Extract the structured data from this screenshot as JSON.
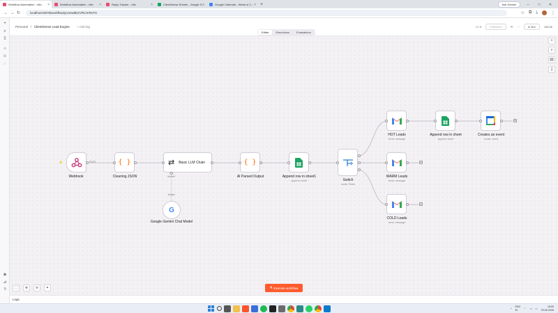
{
  "browser": {
    "tabs": [
      {
        "label": "Workflow Automation - n8n",
        "active": true,
        "color": "#ea4b71"
      },
      {
        "label": "Workflow Automation - n8n",
        "active": false,
        "color": "#ea4b71"
      },
      {
        "label": "Reply Tracker - n8n",
        "active": false,
        "color": "#ea4b71"
      },
      {
        "label": "ClientSense Sheets - Google S...",
        "active": false,
        "color": "#1ea362"
      },
      {
        "label": "Google Calendar - Week of 2...",
        "active": false,
        "color": "#4285f4"
      }
    ],
    "ask_label": "Ask Gemini",
    "url": "localhost:5678/workflow/yUnnw9DzVRCXrRvTS"
  },
  "header": {
    "breadcrumb_root": "Personal",
    "breadcrumb_sep": "/",
    "workflow_name": "ClientSense Lead Engine",
    "add_tag": "+ Add tag",
    "tabs": [
      "Editor",
      "Executions",
      "Evaluations"
    ],
    "counter": "0 / 0",
    "published": "Published",
    "star_label": "Star",
    "star_count": "163.0k"
  },
  "nodes": {
    "webhook": {
      "label": "Webhook",
      "edge": "POST"
    },
    "cleaning": {
      "label": "Cleaning JSON"
    },
    "llm": {
      "label": "Basic LLM Chain",
      "model_port": "Model*"
    },
    "gemini": {
      "label": "Google Gemini Chat Model",
      "edge": "Model"
    },
    "parsed": {
      "label": "AI Parsed Output"
    },
    "append1": {
      "label": "Append row in sheet1",
      "sub": "append: sheet"
    },
    "switch": {
      "label": "Switch",
      "sub": "mode: Rules"
    },
    "hot": {
      "label": "HOT Leads",
      "sub": "send: message"
    },
    "append2": {
      "label": "Append row in sheet",
      "sub": "append: sheet"
    },
    "event": {
      "label": "Creates an event",
      "sub": "create: event"
    },
    "warm": {
      "label": "WARM Leads",
      "sub": "send: message"
    },
    "cold": {
      "label": "COLD Leads",
      "sub": "send: message"
    }
  },
  "execute_button": "Execute workflow",
  "logs_label": "Logs",
  "taskbar": {
    "lang": "ENG\nIN",
    "time": "18:50",
    "date": "29-05-2026"
  },
  "colors": {
    "accent": "#ff5b2e",
    "gmail_red": "#ea4335",
    "sheets_green": "#1ea362",
    "calendar_blue": "#4285f4"
  }
}
